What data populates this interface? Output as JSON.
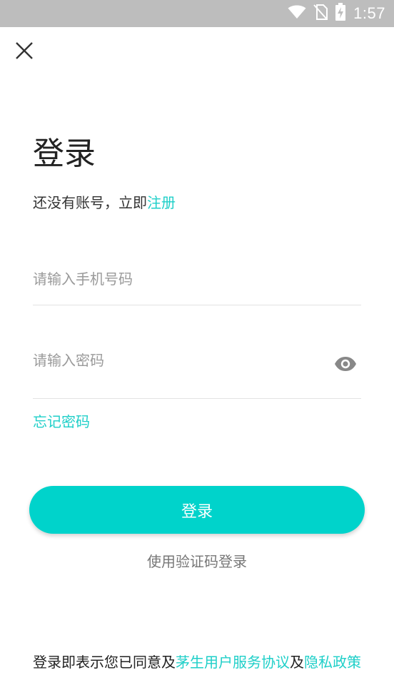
{
  "status_bar": {
    "time": "1:57",
    "icons": [
      "wifi-icon",
      "no-sim-icon",
      "battery-charging-icon"
    ]
  },
  "header": {
    "close_icon": "close-icon"
  },
  "main": {
    "title": "登录",
    "subtitle_prefix": "还没有账号，立即",
    "subtitle_link": "注册",
    "phone_placeholder": "请输入手机号码",
    "phone_value": "",
    "password_placeholder": "请输入密码",
    "password_value": "",
    "eye_icon": "eye-icon",
    "forgot_password": "忘记密码",
    "login_button": "登录",
    "code_login": "使用验证码登录"
  },
  "footer": {
    "agreement_prefix": "登录即表示您已同意及",
    "service_agreement": "茅生用户服务协议",
    "conjunction": "及",
    "privacy_policy": "隐私政策"
  },
  "colors": {
    "accent": "#00d3cb",
    "link": "#1ecfc8",
    "status_bar": "#bdbdbd"
  }
}
